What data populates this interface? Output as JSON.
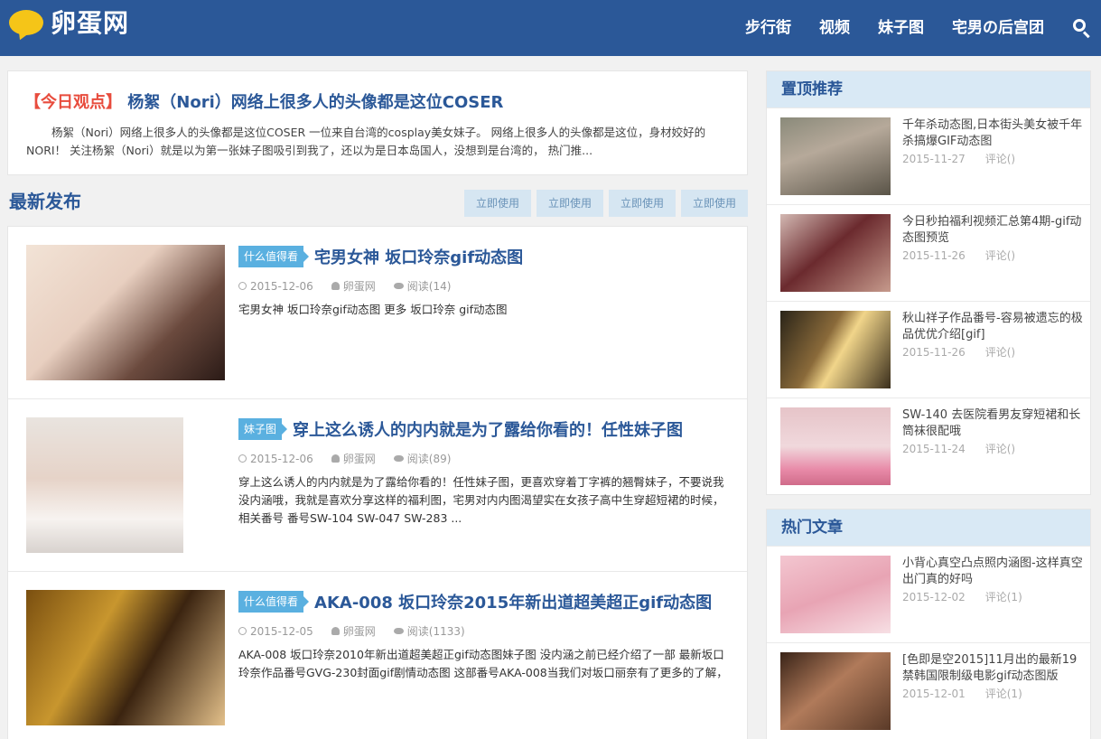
{
  "header": {
    "logo_text": "卵蛋网",
    "nav": [
      "步行街",
      "视频",
      "妹子图",
      "宅男の后宫团"
    ]
  },
  "today": {
    "tag": "【今日观点】",
    "title": "杨絮（Nori）网络上很多人的头像都是这位COSER",
    "text": "杨絮（Nori）网络上很多人的头像都是这位COSER 一位来自台湾的cosplay美女妹子。 网络上很多人的头像都是这位，身材姣好的NORI！ 关注杨絮（Nori）就是以为第一张妹子图吸引到我了，还以为是日本岛国人，没想到是台湾的， 热门推..."
  },
  "latest": {
    "title": "最新发布",
    "buttons": [
      "立即使用",
      "立即使用",
      "立即使用",
      "立即使用"
    ]
  },
  "posts": [
    {
      "category": "什么值得看",
      "title": "宅男女神 坂口玲奈gif动态图",
      "date": "2015-12-06",
      "author": "卵蛋网",
      "views": "阅读(14)",
      "excerpt": "宅男女神 坂口玲奈gif动态图  更多 坂口玲奈 gif动态图"
    },
    {
      "category": "妹子图",
      "title": "穿上这么诱人的内内就是为了露给你看的！任性妹子图",
      "date": "2015-12-06",
      "author": "卵蛋网",
      "views": "阅读(89)",
      "excerpt": "穿上这么诱人的内内就是为了露给你看的！任性妹子图，更喜欢穿着丁字裤的翘臀妹子，不要说我没内涵哦，我就是喜欢分享这样的福利图，宅男对内内图渴望实在女孩子高中生穿超短裙的时候，相关番号 番号SW-104    SW-047   SW-283  ..."
    },
    {
      "category": "什么值得看",
      "title": "AKA-008 坂口玲奈2015年新出道超美超正gif动态图",
      "date": "2015-12-05",
      "author": "卵蛋网",
      "views": "阅读(1133)",
      "excerpt": "AKA-008 坂口玲奈2010年新出道超美超正gif动态图妹子图 没内涵之前已经介绍了一部 最新坂口玲奈作品番号GVG-230封面gif剧情动态图 这部番号AKA-008当我们对坂口丽奈有了更多的了解，"
    }
  ],
  "sidebar": {
    "top": {
      "title": "置顶推荐",
      "items": [
        {
          "title": "千年杀动态图,日本街头美女被千年杀搞爆GIF动态图",
          "date": "2015-11-27",
          "comments": "评论()"
        },
        {
          "title": "今日秒拍福利视频汇总第4期-gif动态图预览",
          "date": "2015-11-26",
          "comments": "评论()"
        },
        {
          "title": "秋山祥子作品番号-容易被遗忘的极品优优介绍[gif]",
          "date": "2015-11-26",
          "comments": "评论()"
        },
        {
          "title": "SW-140 去医院看男友穿短裙和长筒袜很配哦",
          "date": "2015-11-24",
          "comments": "评论()"
        }
      ]
    },
    "hot": {
      "title": "热门文章",
      "items": [
        {
          "title": "小背心真空凸点照内涵图-这样真空出门真的好吗",
          "date": "2015-12-02",
          "comments": "评论(1)"
        },
        {
          "title": "[色即是空2015]11月出的最新19禁韩国限制级电影gif动态图版",
          "date": "2015-12-01",
          "comments": "评论(1)"
        }
      ]
    }
  },
  "colors": {
    "header_bg": "#2b5898",
    "accent_red": "#e84c3d",
    "category_bg": "#5ab0e0"
  }
}
